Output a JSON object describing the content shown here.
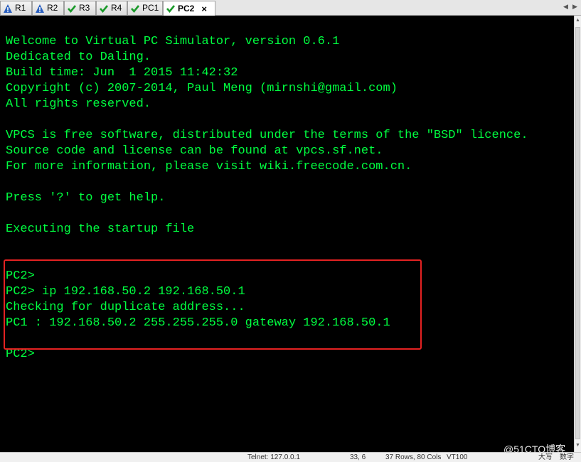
{
  "tabs": [
    {
      "label": "R1",
      "status": "warning-icon"
    },
    {
      "label": "R2",
      "status": "warning-icon"
    },
    {
      "label": "R3",
      "status": "check-icon"
    },
    {
      "label": "R4",
      "status": "check-icon"
    },
    {
      "label": "PC1",
      "status": "check-icon"
    },
    {
      "label": "PC2",
      "status": "check-icon",
      "active": true,
      "close": "×"
    }
  ],
  "nav": {
    "left": "◀",
    "right": "▶"
  },
  "terminal": {
    "text_color": "#00ff40",
    "background": "#000000",
    "lines": [
      "Welcome to Virtual PC Simulator, version 0.6.1",
      "Dedicated to Daling.",
      "Build time: Jun  1 2015 11:42:32",
      "Copyright (c) 2007-2014, Paul Meng (mirnshi@gmail.com)",
      "All rights reserved.",
      "",
      "VPCS is free software, distributed under the terms of the \"BSD\" licence.",
      "Source code and license can be found at vpcs.sf.net.",
      "For more information, please visit wiki.freecode.com.cn.",
      "",
      "Press '?' to get help.",
      "",
      "Executing the startup file",
      "",
      "",
      "PC2>",
      "PC2> ip 192.168.50.2 192.168.50.1",
      "Checking for duplicate address...",
      "PC1 : 192.168.50.2 255.255.255.0 gateway 192.168.50.1",
      "",
      "PC2>"
    ]
  },
  "highlight_color": "#e52222",
  "statusbar": {
    "item1": "Telnet: 127.0.0.1",
    "item2": "33,  6",
    "item3": "37 Rows, 80 Cols",
    "item4": "VT100",
    "item5": "大写",
    "item6": "数字"
  },
  "watermark": "@51CTO博客"
}
